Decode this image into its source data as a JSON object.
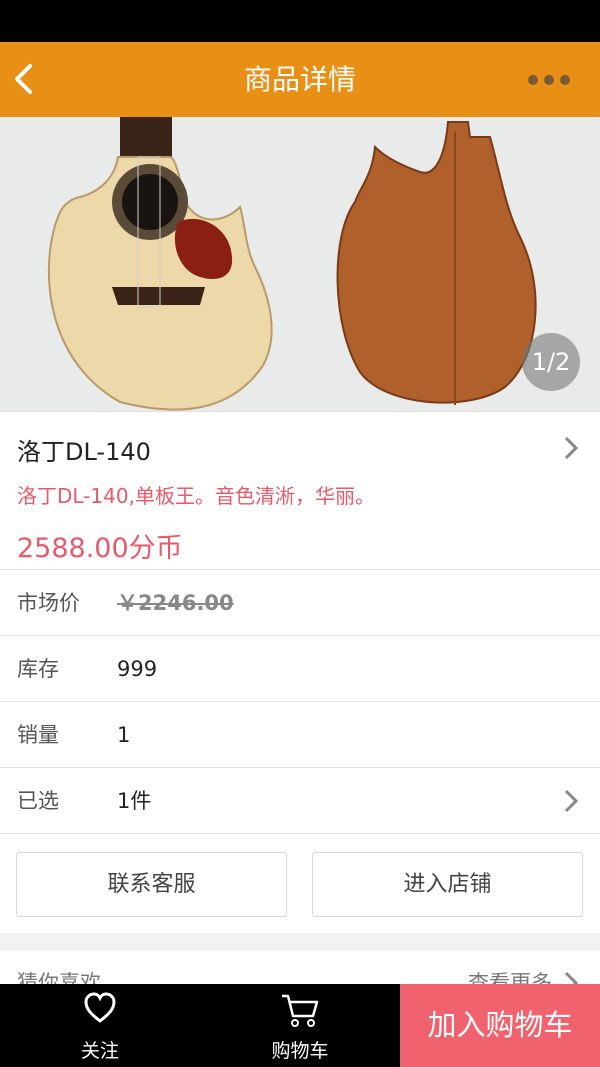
{
  "header": {
    "title": "商品详情"
  },
  "gallery": {
    "page_indicator": "1/2"
  },
  "product": {
    "name": "洛丁DL-140",
    "description": "洛丁DL-140,单板王。音色清淅，华丽。",
    "price": "2588.00分币"
  },
  "details": [
    {
      "label": "市场价",
      "value": "￥2246.00"
    },
    {
      "label": "库存",
      "value": "999"
    },
    {
      "label": "销量",
      "value": "1"
    },
    {
      "label": "已选",
      "value": "1件"
    }
  ],
  "actions": {
    "contact": "联系客服",
    "store": "进入店铺"
  },
  "recommend": {
    "title": "猜你喜欢",
    "more": "查看更多"
  },
  "tabbar": {
    "follow": "关注",
    "cart": "购物车",
    "add_to_cart": "加入购物车"
  },
  "colors": {
    "header": "#e88f15",
    "accent": "#f0636e",
    "price": "#e55b6a"
  }
}
